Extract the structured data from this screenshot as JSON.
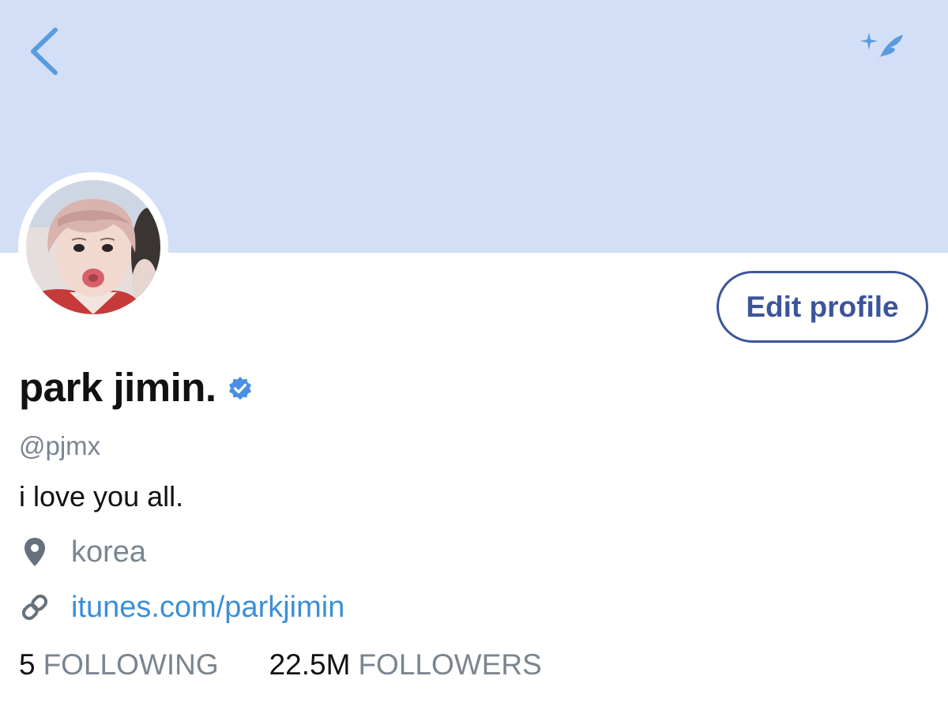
{
  "colors": {
    "header_bg": "#d3dff7",
    "accent": "#3b559c",
    "link": "#3b8fd8",
    "verified": "#4a90e2",
    "muted": "#7a8591"
  },
  "icons": {
    "back": "chevron-left-icon",
    "compose": "compose-tweet-icon",
    "verified": "verified-badge-icon",
    "location": "location-pin-icon",
    "link": "link-icon"
  },
  "profile": {
    "display_name": "park jimin.",
    "handle": "@pjmx",
    "bio": "i love you all.",
    "location": "korea",
    "website": "itunes.com/parkjimin",
    "verified": true
  },
  "actions": {
    "edit_profile_label": "Edit profile"
  },
  "stats": {
    "following_count": "5",
    "following_label": "FOLLOWING",
    "followers_count": "22.5M",
    "followers_label": "FOLLOWERS"
  }
}
